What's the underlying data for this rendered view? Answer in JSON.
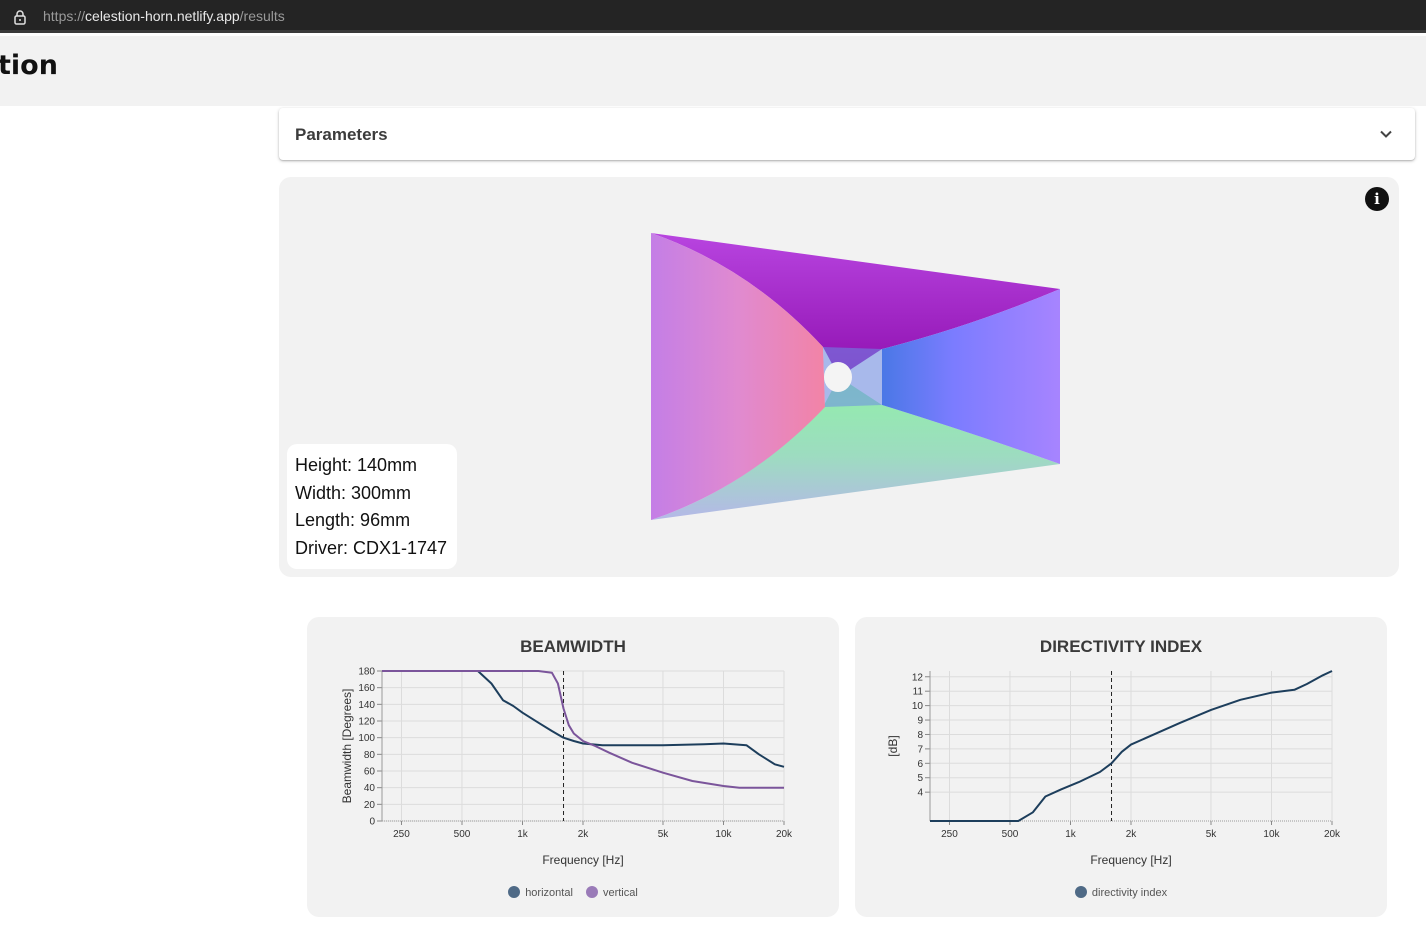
{
  "browser": {
    "url_scheme": "https://",
    "url_host": "celestion-horn.netlify.app",
    "url_path": "/results"
  },
  "header": {
    "logo_text": "tion"
  },
  "parameters": {
    "title": "Parameters"
  },
  "viewer": {
    "height": "Height: 140mm",
    "width": "Width: 300mm",
    "length": "Length: 96mm",
    "driver": "Driver: CDX1-1747",
    "info_icon": "info-icon"
  },
  "colors": {
    "horizontal": "#1d3e5c",
    "vertical": "#7b559b",
    "directivity": "#1d3e5c",
    "card_bg": "#f2f2f2"
  },
  "chart_data": [
    {
      "type": "line",
      "title": "BEAMWIDTH",
      "xlabel": "Frequency [Hz]",
      "ylabel": "Beamwidth [Degrees]",
      "x_scale": "log",
      "xlim": [
        200,
        20000
      ],
      "ylim": [
        0,
        180
      ],
      "x_ticks": [
        250,
        500,
        1000,
        2000,
        5000,
        10000,
        20000
      ],
      "x_tick_labels": [
        "250",
        "500",
        "1k",
        "2k",
        "5k",
        "10k",
        "20k"
      ],
      "y_ticks": [
        0,
        20,
        40,
        60,
        80,
        100,
        120,
        140,
        160,
        180
      ],
      "y_tick_labels": [
        "0",
        "20",
        "40",
        "60",
        "80",
        "100",
        "120",
        "140",
        "160",
        "180"
      ],
      "marker_line_x": 1600,
      "grid": true,
      "legend": "bottom",
      "series": [
        {
          "name": "horizontal",
          "x": [
            200,
            500,
            600,
            700,
            800,
            900,
            1000,
            1200,
            1400,
            1600,
            1800,
            2000,
            2500,
            3000,
            5000,
            8000,
            10000,
            13000,
            15000,
            18000,
            20000
          ],
          "y": [
            180,
            180,
            180,
            165,
            145,
            138,
            130,
            118,
            108,
            100,
            96,
            93,
            91,
            91,
            91,
            92,
            93,
            91,
            80,
            68,
            65
          ]
        },
        {
          "name": "vertical",
          "x": [
            200,
            800,
            1200,
            1400,
            1500,
            1600,
            1700,
            1800,
            2000,
            2300,
            2700,
            3500,
            5000,
            7000,
            10000,
            12000,
            20000
          ],
          "y": [
            180,
            180,
            180,
            178,
            165,
            135,
            115,
            105,
            96,
            90,
            82,
            70,
            58,
            48,
            42,
            40,
            40
          ]
        }
      ]
    },
    {
      "type": "line",
      "title": "DIRECTIVITY INDEX",
      "xlabel": "Frequency [Hz]",
      "ylabel": "[dB]",
      "x_scale": "log",
      "xlim": [
        200,
        20000
      ],
      "ylim": [
        2,
        12.4
      ],
      "x_ticks": [
        250,
        500,
        1000,
        2000,
        5000,
        10000,
        20000
      ],
      "x_tick_labels": [
        "250",
        "500",
        "1k",
        "2k",
        "5k",
        "10k",
        "20k"
      ],
      "y_ticks": [
        4,
        5,
        6,
        7,
        8,
        9,
        10,
        11,
        12
      ],
      "y_tick_labels": [
        "4",
        "5",
        "6",
        "7",
        "8",
        "9",
        "10",
        "11",
        "12"
      ],
      "marker_line_x": 1600,
      "grid": true,
      "legend": "bottom",
      "series": [
        {
          "name": "directivity index",
          "x": [
            200,
            550,
            650,
            750,
            900,
            1100,
            1400,
            1600,
            1800,
            2000,
            2500,
            3500,
            5000,
            7000,
            10000,
            13000,
            15000,
            18000,
            20000
          ],
          "y": [
            2,
            2,
            2.6,
            3.7,
            4.2,
            4.7,
            5.4,
            6.0,
            6.8,
            7.3,
            7.9,
            8.8,
            9.7,
            10.4,
            10.9,
            11.1,
            11.5,
            12.1,
            12.4
          ]
        }
      ]
    }
  ]
}
